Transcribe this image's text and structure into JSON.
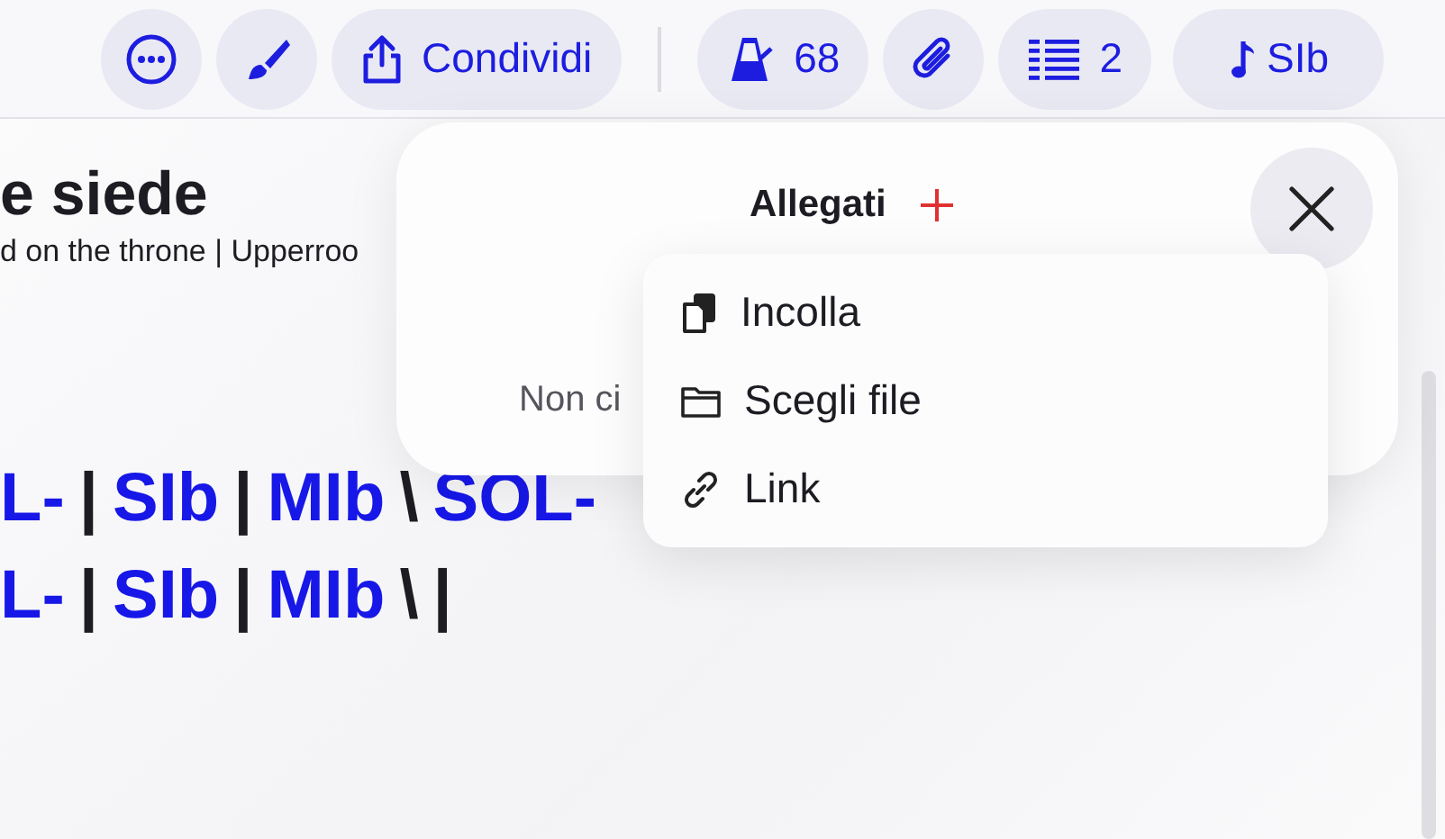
{
  "toolbar": {
    "buttons": [
      {
        "kind": "more"
      },
      {
        "kind": "brush"
      },
      {
        "kind": "share",
        "label": "Condividi"
      },
      {
        "kind": "metronome",
        "label": "68"
      },
      {
        "kind": "attach"
      },
      {
        "kind": "list",
        "label": "2"
      },
      {
        "kind": "note",
        "label": "SIb"
      }
    ]
  },
  "song": {
    "title": "e siede",
    "subtitle": "d on the throne | Upperroo",
    "lines": [
      {
        "chords": [
          "L-",
          "SIb",
          "MIb",
          "SOL-"
        ],
        "separators": [
          "|",
          "|",
          "\\"
        ]
      },
      {
        "chords": [
          "L-",
          "SIb",
          "MIb"
        ],
        "separators": [
          "|",
          "|",
          "\\",
          "|"
        ]
      }
    ]
  },
  "attachments_panel": {
    "title": "Allegati",
    "empty_text": "Non ci"
  },
  "menu": {
    "items": [
      {
        "kind": "paste",
        "label": "Incolla"
      },
      {
        "kind": "folder",
        "label": "Scegli file"
      },
      {
        "kind": "link",
        "label": "Link"
      }
    ]
  }
}
